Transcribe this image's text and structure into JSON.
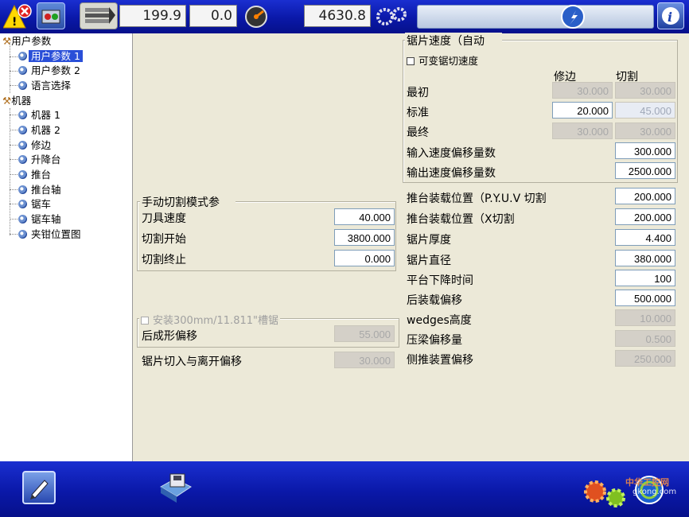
{
  "toolbar": {
    "readout_1": "199.9",
    "readout_2": "0.0",
    "readout_3": "4630.8",
    "icons": [
      "alarm-icon",
      "operator-panel-icon",
      "stack-icon",
      "gauge-icon",
      "gear-pair-icon",
      "compass-icon",
      "info-icon"
    ]
  },
  "tree": {
    "groups": [
      {
        "label": "用户参数",
        "items": [
          {
            "label": "用户参数 1",
            "selected": true
          },
          {
            "label": "用户参数 2"
          },
          {
            "label": "语言选择"
          }
        ]
      },
      {
        "label": "机器",
        "items": [
          {
            "label": "机器 1"
          },
          {
            "label": "机器 2"
          },
          {
            "label": "修边"
          },
          {
            "label": "升降台"
          },
          {
            "label": "推台"
          },
          {
            "label": "推台轴"
          },
          {
            "label": "锯车"
          },
          {
            "label": "锯车轴"
          },
          {
            "label": "夹钳位置图"
          }
        ]
      }
    ]
  },
  "manual_cut": {
    "title": "手动切割模式参",
    "rows": [
      {
        "label": "刀具速度",
        "value": "40.000"
      },
      {
        "label": "切割开始",
        "value": "3800.000"
      },
      {
        "label": "切割终止",
        "value": "0.000"
      }
    ]
  },
  "groove": {
    "title": "安装300mm/11.811\"槽锯",
    "row_label": "后成形偏移",
    "row_value": "55.000"
  },
  "blade_in_out": {
    "label": "锯片切入与离开偏移",
    "value": "30.000"
  },
  "blade_speed": {
    "title": "锯片速度（自动",
    "checkbox_label": "可变锯切速度",
    "col_trim": "修边",
    "col_cut": "切割",
    "rows": [
      {
        "label": "最初",
        "trim": "30.000",
        "cut": "30.000"
      },
      {
        "label": "标准",
        "trim": "20.000",
        "cut": "45.000"
      },
      {
        "label": "最终",
        "trim": "30.000",
        "cut": "30.000"
      }
    ],
    "in_offset_label": "输入速度偏移量数",
    "in_offset_value": "300.000",
    "out_offset_label": "输出速度偏移量数",
    "out_offset_value": "2500.000"
  },
  "right_params": [
    {
      "label": "推台装载位置（P.Y.U.V 切割",
      "value": "200.000"
    },
    {
      "label": "推台装载位置（X切割",
      "value": "200.000"
    },
    {
      "label": "锯片厚度",
      "value": "4.400"
    },
    {
      "label": "锯片直径",
      "value": "380.000"
    },
    {
      "label": "平台下降时间",
      "value": "100"
    },
    {
      "label": "后装载偏移",
      "value": "500.000"
    },
    {
      "label": "wedges高度",
      "value": "10.000"
    },
    {
      "label": "压梁偏移量",
      "value": "0.500"
    },
    {
      "label": "侧推装置偏移",
      "value": "250.000"
    }
  ],
  "bottom": {
    "icons": [
      "edit-hand-icon",
      "save-disk-icon",
      "gears-logo-icon"
    ],
    "watermark_1": "中华工控网",
    "watermark_2": "gkong.com"
  }
}
